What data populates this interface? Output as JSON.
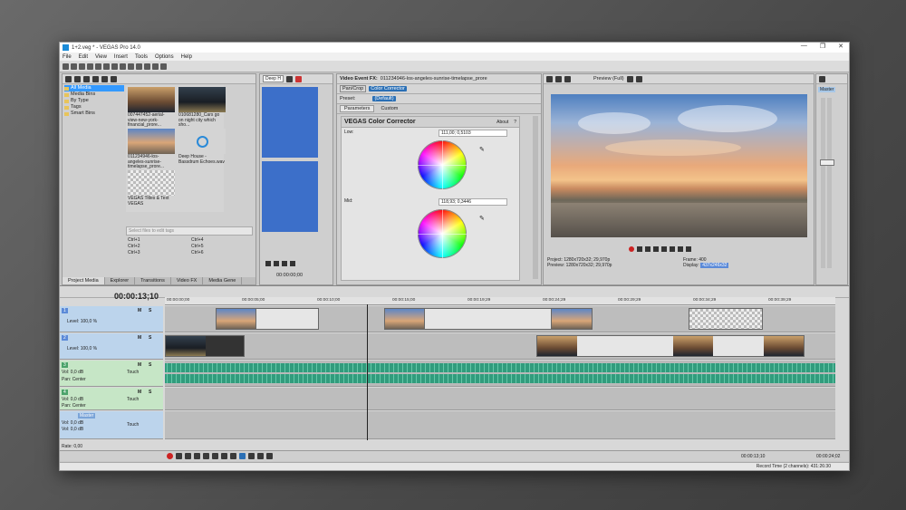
{
  "window": {
    "title": "1+2.veg * - VEGAS Pro 14.0"
  },
  "menu": [
    "File",
    "Edit",
    "View",
    "Insert",
    "Tools",
    "Options",
    "Help"
  ],
  "explorer": {
    "tree": [
      "All Media",
      "Media Bins",
      "By Type",
      "Tags",
      "Smart Bins"
    ],
    "media": [
      {
        "caption": "007447452-aerial-view-new-york-financial_prore..."
      },
      {
        "caption": "010681280_Cars go on night city which sho..."
      },
      {
        "caption": "011234946-los-angeles-sunrise-timelapse_prore..."
      },
      {
        "caption": "Deep House - Bassdrum Echoes.wav"
      },
      {
        "caption": "VEGAS Titles & Text VEGAS"
      }
    ],
    "tag_placeholder": "Select files to edit tags",
    "shortcuts": [
      "Ctrl+1",
      "Ctrl+4",
      "Ctrl+2",
      "Ctrl+5",
      "Ctrl+3",
      "Ctrl+6"
    ],
    "tabs": [
      "Project Media",
      "Explorer",
      "Transitions",
      "Video FX",
      "Media Gene"
    ]
  },
  "trimmer": {
    "clip_name": "Deep H",
    "timecode": "00:00:00;00"
  },
  "fx": {
    "title": "Video Event FX:",
    "clip": "011234946-los-angeles-sunrise-timelapse_prore",
    "chain": [
      "Pan/Crop",
      "Color Corrector"
    ],
    "preset_label": "Preset:",
    "preset_value": "(Default)",
    "tabs": [
      "Parameters",
      "Custom"
    ],
    "plugin_name": "VEGAS Color Corrector",
    "about": "About",
    "help": "?",
    "low_label": "Low:",
    "low_value": "111,00; 0,5103",
    "mid_label": "Mid:",
    "mid_value": "118,93; 0,3446"
  },
  "preview": {
    "mode": "Preview (Full)",
    "project_label": "Project:",
    "project_value": "1280x720x32; 29,970p",
    "preview_label": "Preview:",
    "preview_value": "1280x720x32; 29,970p",
    "frame_label": "Frame:",
    "frame_value": "400",
    "display_label": "Display:",
    "display_value": "437x246x32"
  },
  "master": {
    "label": "Master"
  },
  "timeline": {
    "timecode": "00:00:13;10",
    "ruler": [
      "00:00:00;00",
      "00:00:05;00",
      "00:00:10;00",
      "00:00:15;00",
      "00:00:19;29",
      "00:00:24;29",
      "00:00:29;29",
      "00:00:34;29",
      "00:00:39;29"
    ],
    "tracks": [
      {
        "num": "1",
        "level": "Level: 100,0 %"
      },
      {
        "num": "2",
        "level": "Level: 100,0 %"
      },
      {
        "num": "3",
        "vol": "0,0 dB",
        "pan": "Center",
        "mode": "Touch"
      },
      {
        "num": "4",
        "vol": "0,0 dB",
        "pan": "Center",
        "mode": "Touch"
      },
      {
        "num": "Master",
        "vol": "0,0 dB",
        "vol2": "0,0 dB",
        "mode": "Touch"
      }
    ],
    "rate": "Rate: 0,00",
    "cursor_time": "00:00:13;10",
    "end_time": "00:00:24;02",
    "record_time": "Record Time (2 channels): 431:26:30"
  }
}
